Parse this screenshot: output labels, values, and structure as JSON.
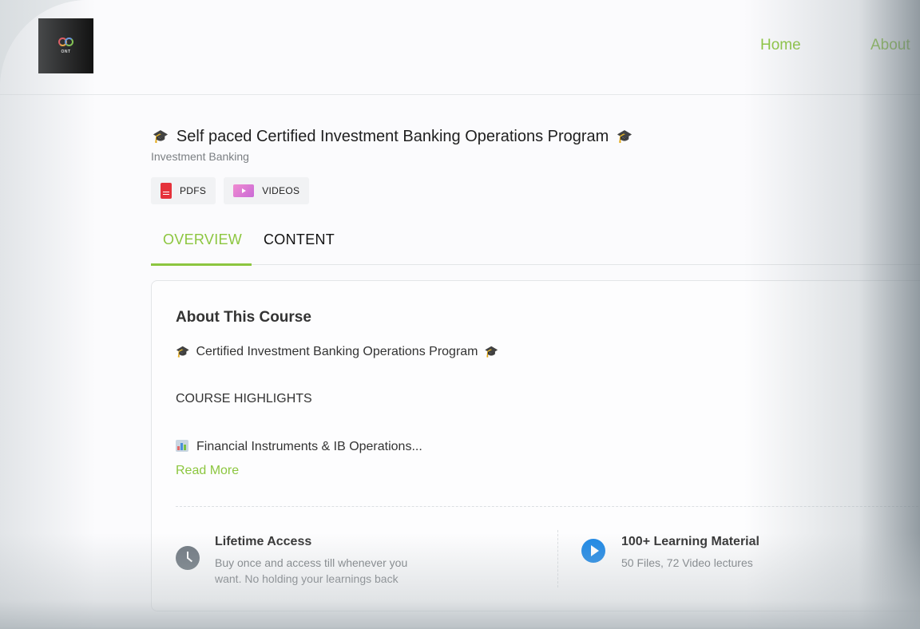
{
  "header": {
    "logo_text": "ONT",
    "nav": {
      "home": "Home",
      "about": "About"
    }
  },
  "course": {
    "cap_emoji": "🎓",
    "title": "Self paced Certified Investment Banking Operations Program",
    "category": "Investment Banking",
    "chips": {
      "pdfs": "PDFS",
      "videos": "VIDEOS"
    }
  },
  "tabs": {
    "overview": "OVERVIEW",
    "content": "CONTENT"
  },
  "about": {
    "heading": "About This Course",
    "line1": "Certified Investment Banking Operations Program",
    "line2": "COURSE HIGHLIGHTS",
    "line3": "Financial Instruments & IB Operations...",
    "read_more": "Read More"
  },
  "features": {
    "lifetime": {
      "title": "Lifetime Access",
      "desc": "Buy once and access till whenever you want. No holding your learnings back"
    },
    "material": {
      "title": "100+ Learning Material",
      "desc": "50 Files, 72 Video lectures"
    }
  },
  "colors": {
    "accent": "#8cc63f",
    "play": "#1e88e5",
    "pdf": "#e5323b"
  }
}
